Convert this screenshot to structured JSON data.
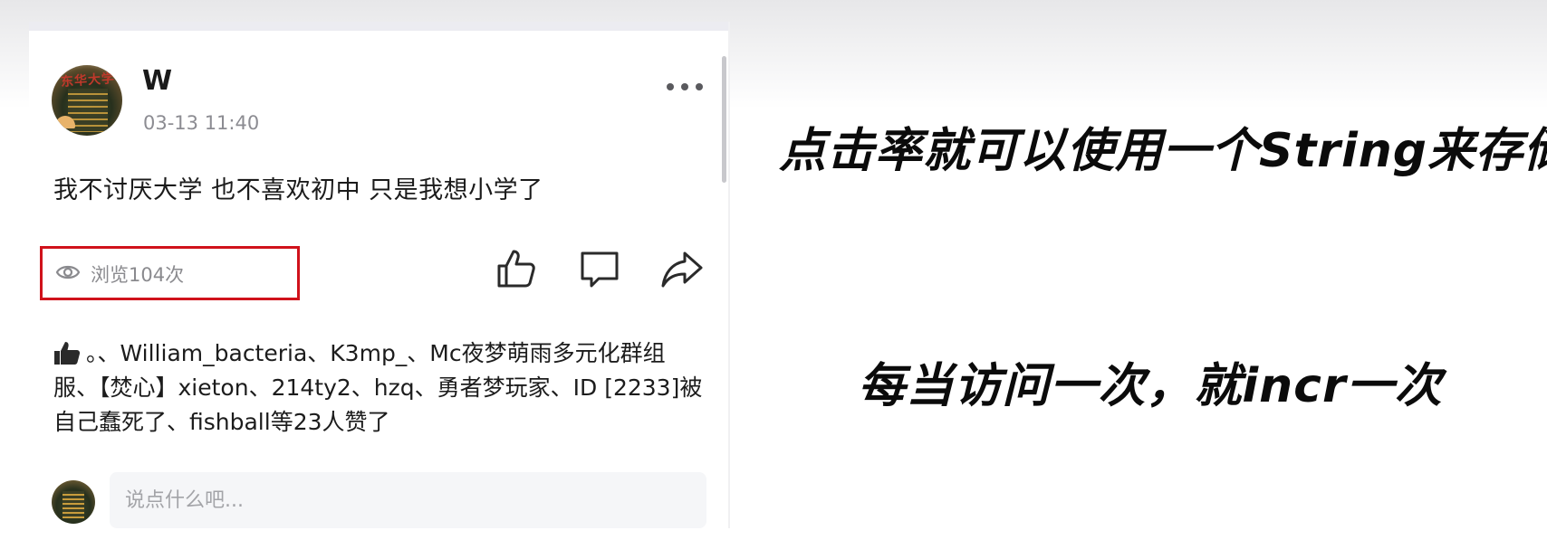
{
  "post": {
    "username": "W",
    "time": "03-13 11:40",
    "content": "我不讨厌大学 也不喜欢初中 只是我想小学了",
    "views_label": "浏览104次",
    "likes_text": "。、William_bacteria、K3mp_、Mc夜梦萌雨多元化群组服、【焚心】xieton、214ty2、hzq、勇者梦玩家、ID [2233]被自己蠢死了、fishball等23人赞了",
    "avatar_banner": "东华大学"
  },
  "comment": {
    "placeholder": "说点什么吧..."
  },
  "annotations": {
    "line1": "点击率就可以使用一个String来存储",
    "line2": "每当访问一次，就incr一次"
  },
  "colors": {
    "highlight_box": "#d0121b",
    "meta_gray": "#8c8c92",
    "text": "#1b1b1b",
    "input_bg": "#f5f6f8"
  },
  "icons": [
    "eye-icon",
    "thumbs-up-icon",
    "comment-icon",
    "share-icon",
    "more-icon",
    "thumb-filled-icon"
  ]
}
